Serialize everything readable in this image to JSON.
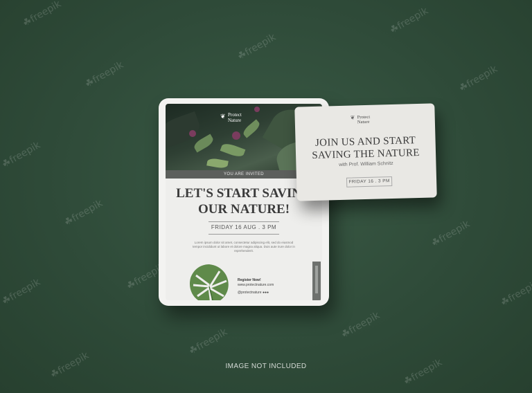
{
  "watermark": {
    "text": "freepik"
  },
  "tablet": {
    "brand": {
      "line1": "Protect",
      "line2": "Nature",
      "icon": "leaf-icon"
    },
    "invited": "YOU ARE INVITED",
    "headline_line1": "LET'S START SAVING",
    "headline_line2": "OUR NATURE!",
    "date": "FRIDAY 16 AUG . 3 PM",
    "body_text": "Lorem ipsum dolor sit amet, consectetur adipiscing elit, sed do eiusmod tempor incididunt ut labore et dolore magna aliqua. Duis aute irure dolor in reprehenderit.",
    "register": {
      "title": "Register Now!",
      "site": "www.protectnature.com",
      "social_handle": "@protectnature"
    }
  },
  "card": {
    "brand": {
      "line1": "Protect",
      "line2": "Nature",
      "icon": "leaf-icon"
    },
    "headline_line1": "JOIN US AND START",
    "headline_line2": "SAVING THE NATURE",
    "subtitle": "with Prof. William Schnitz",
    "date": "FRIDAY 16 . 3 PM"
  },
  "footer": {
    "text": "IMAGE NOT INCLUDED"
  },
  "colors": {
    "background": "#2f4a38",
    "paper": "#eeeeec",
    "text": "#3b3b3b"
  }
}
